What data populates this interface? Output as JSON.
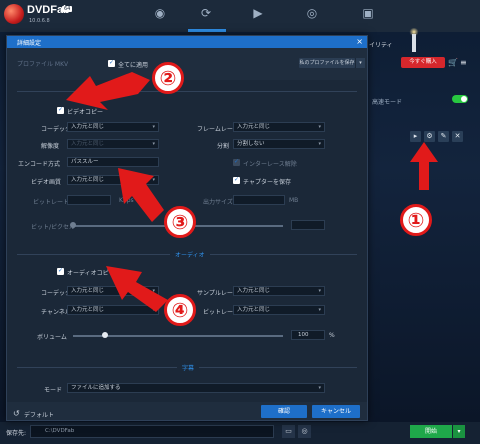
{
  "app": {
    "brand": "DVDFab",
    "brand_tag": "64",
    "version": "10.0.6.8",
    "bg_hint": "イリティ",
    "bg_label": "高速モード",
    "buy_label": "今すぐ購入",
    "save_label": "保存先:",
    "save_path": "C:\\DVDFab",
    "start_label": "開始"
  },
  "dialog": {
    "title": "詳細設定",
    "close": "×",
    "profile_text": "プロファイル  MKV",
    "apply_all": "全てに適用",
    "save_profile": "私のプロファイルを保存",
    "video": {
      "copy_label": "ビデオコピー",
      "codec_label": "コーデック",
      "codec_value": "入力元と同じ",
      "resolution_label": "解像度",
      "resolution_value": "入力元と同じ",
      "encode_label": "エンコード方式",
      "encode_value": "パススルー",
      "quality_label": "ビデオ画質",
      "quality_value": "入力元と同じ",
      "bitrate_label": "ビットレート",
      "bitrate_unit": "Kbps",
      "bpp_label": "ビット/ピクセル",
      "framerate_label": "フレームレート",
      "framerate_value": "入力元と同じ",
      "split_label": "分割",
      "split_value": "分割しない",
      "deinterlace_label": "インターレース解除",
      "chapter_label": "チャプターを保存",
      "output_size_label": "出力サイズ",
      "output_size_unit": "MB"
    },
    "audio": {
      "section_title": "オーディオ",
      "copy_label": "オーディオコピー",
      "codec_label": "コーデック",
      "codec_value": "入力元と同じ",
      "channel_label": "チャンネル",
      "channel_value": "入力元と同じ",
      "samplerate_label": "サンプルレート",
      "samplerate_value": "入力元と同じ",
      "bitrate_label": "ビットレート",
      "bitrate_value": "入力元と同じ",
      "volume_label": "ボリューム",
      "volume_value": "100",
      "volume_unit": "%",
      "volume_fraction": 0.15
    },
    "subtitle": {
      "section_title": "字幕",
      "mode_label": "モード",
      "mode_value": "ファイルに追加する"
    },
    "footer": {
      "default_label": "デフォルト",
      "ok_label": "確認",
      "cancel_label": "キャンセル"
    }
  },
  "annotations": [
    "①",
    "②",
    "③",
    "④"
  ],
  "colors": {
    "accent": "#1e6fc9",
    "annotation": "#e11a1a",
    "start": "#1fa84a",
    "buy": "#d6272c"
  }
}
